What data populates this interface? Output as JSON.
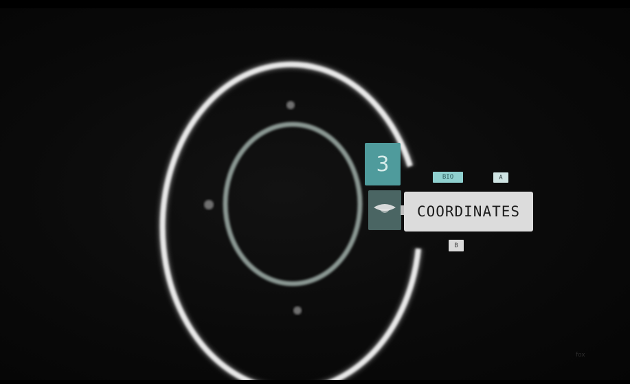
{
  "hud": {
    "number_tile": "3",
    "icon_tile": "eye-icon",
    "label": "COORDINATES",
    "chip_top_left": "BIO",
    "chip_top_right": "A",
    "chip_bottom": "B",
    "watermark": "fox"
  },
  "colors": {
    "background": "#0a0a0a",
    "outer_ring": "#e8e8e8",
    "inner_ring": "#8a9793",
    "accent_teal": "#4f9b9c",
    "icon_tile": "#4a6563",
    "label_background": "#dcdcdc"
  }
}
